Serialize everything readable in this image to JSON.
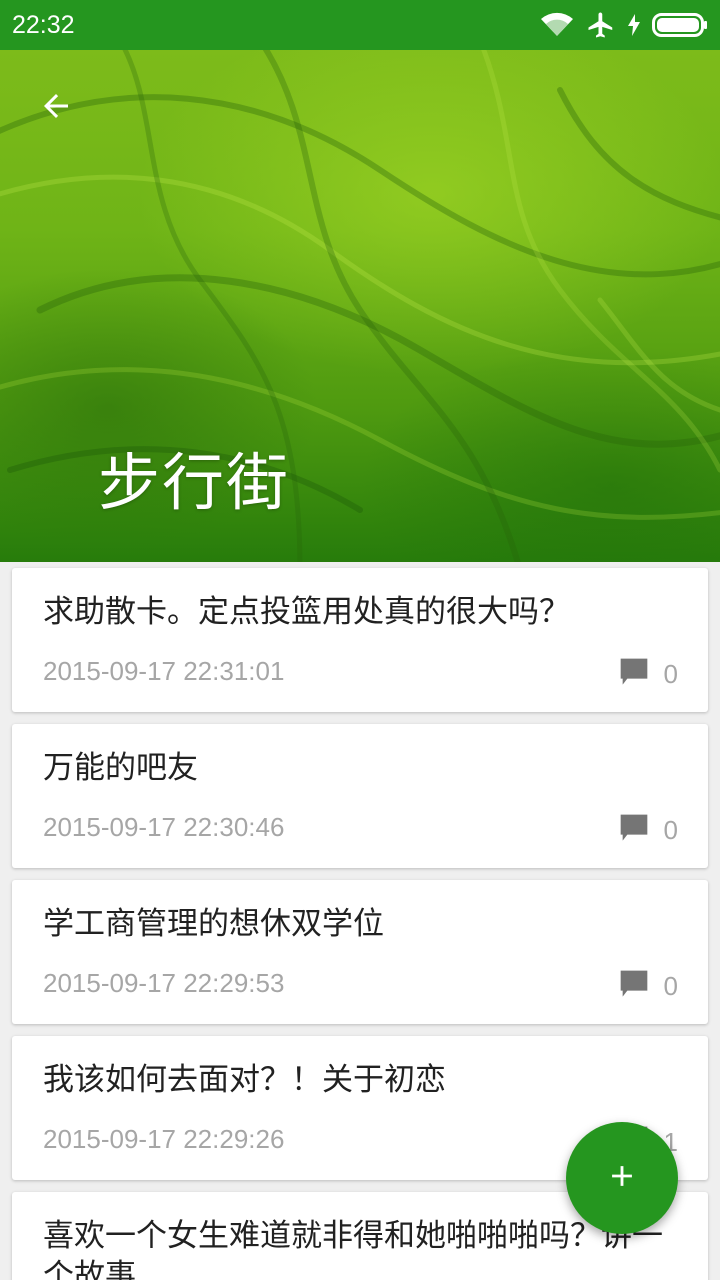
{
  "status_bar": {
    "time": "22:32"
  },
  "header": {
    "title": "步行街"
  },
  "colors": {
    "primary": "#25961f",
    "meta_text": "#a6a6a6",
    "title_text": "#212121"
  },
  "posts": [
    {
      "title": "求助散卡。定点投篮用处真的很大吗？",
      "time": "2015-09-17 22:31:01",
      "comments": "0"
    },
    {
      "title": "万能的吧友",
      "time": "2015-09-17 22:30:46",
      "comments": "0"
    },
    {
      "title": "学工商管理的想休双学位",
      "time": "2015-09-17 22:29:53",
      "comments": "0"
    },
    {
      "title": "我该如何去面对？！关于初恋",
      "time": "2015-09-17 22:29:26",
      "comments": "1"
    },
    {
      "title": "喜欢一个女生难道就非得和她啪啪啪吗？讲一个故事",
      "time": "",
      "comments": ""
    }
  ],
  "icons": {
    "status": [
      "wifi-icon",
      "airplane-icon",
      "charging-icon",
      "battery-icon"
    ],
    "back": "back-arrow-icon",
    "comment": "comment-icon",
    "fab": "plus-icon"
  }
}
